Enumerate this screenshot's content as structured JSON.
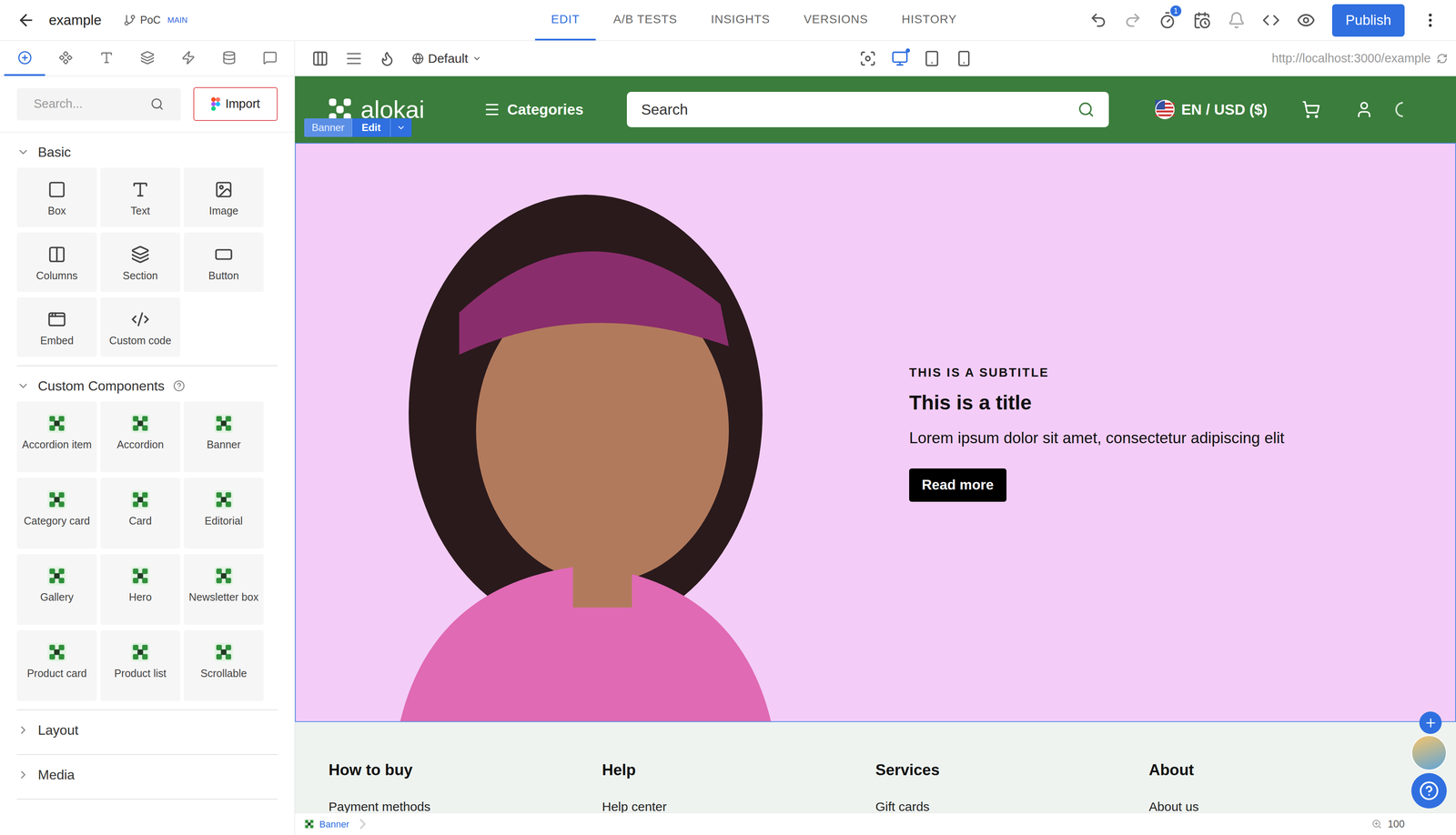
{
  "topbar": {
    "title": "example",
    "branch": "PoC",
    "branch_badge": "MAIN",
    "tabs": [
      {
        "label": "EDIT",
        "selected": true
      },
      {
        "label": "A/B TESTS",
        "selected": false
      },
      {
        "label": "INSIGHTS",
        "selected": false
      },
      {
        "label": "VERSIONS",
        "selected": false
      },
      {
        "label": "HISTORY",
        "selected": false
      }
    ],
    "notification_badge": "1",
    "publish": "Publish"
  },
  "sidebar": {
    "tabs": [
      {
        "selected": true
      },
      {
        "selected": false
      },
      {
        "selected": false
      },
      {
        "selected": false
      },
      {
        "selected": false
      },
      {
        "selected": false
      },
      {
        "selected": false
      }
    ],
    "search_placeholder": "Search...",
    "import": "Import",
    "sections": [
      {
        "title": "Basic",
        "kind": "basic",
        "expanded": true,
        "help": false,
        "items": [
          "Box",
          "Text",
          "Image",
          "Columns",
          "Section",
          "Button",
          "Embed",
          "Custom code"
        ]
      },
      {
        "title": "Custom Components",
        "kind": "custom",
        "expanded": true,
        "help": true,
        "items": [
          "Accordion item",
          "Accordion",
          "Banner",
          "Category card",
          "Card",
          "Editorial",
          "Gallery",
          "Hero",
          "Newsletter box",
          "Product card",
          "Product list",
          "Scrollable"
        ]
      },
      {
        "title": "Layout",
        "kind": "basic",
        "expanded": false,
        "help": false,
        "items": []
      },
      {
        "title": "Media",
        "kind": "basic",
        "expanded": false,
        "help": false,
        "items": []
      }
    ]
  },
  "canvas_toolbar": {
    "locale": "Default",
    "devices": [
      {
        "selected": true
      },
      {
        "selected": false
      },
      {
        "selected": false
      }
    ],
    "url": "http://localhost:3000/example"
  },
  "site": {
    "header": {
      "logo": "alokai",
      "categories": "Categories",
      "search_placeholder": "Search",
      "locale": "EN / USD ($)"
    },
    "selection": {
      "label": "Banner",
      "edit": "Edit"
    },
    "banner": {
      "subtitle": "THIS IS A SUBTITLE",
      "title": "This is a title",
      "description": "Lorem ipsum dolor sit amet, consectetur adipiscing elit",
      "button": "Read more"
    },
    "footer": [
      {
        "heading": "How to buy",
        "links": [
          "Payment methods"
        ]
      },
      {
        "heading": "Help",
        "links": [
          "Help center"
        ]
      },
      {
        "heading": "Services",
        "links": [
          "Gift cards"
        ]
      },
      {
        "heading": "About",
        "links": [
          "About us"
        ]
      }
    ]
  },
  "status_bar": {
    "breadcrumb": "Banner",
    "zoom": "100"
  }
}
